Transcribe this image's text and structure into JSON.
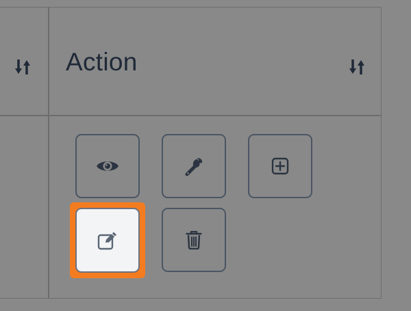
{
  "table": {
    "action_header": {
      "title": "Action"
    },
    "prev_column": {
      "sort_icon": "sort-arrows-icon"
    },
    "actions": [
      {
        "name": "view",
        "icon": "eye-icon"
      },
      {
        "name": "configure",
        "icon": "wrench-icon"
      },
      {
        "name": "add",
        "icon": "plus-square-icon"
      },
      {
        "name": "edit",
        "icon": "edit-icon",
        "highlighted": true
      },
      {
        "name": "delete",
        "icon": "trash-icon"
      }
    ]
  },
  "colors": {
    "background": "#898989",
    "highlight": "#f47c20",
    "icon": "#1f2937"
  }
}
